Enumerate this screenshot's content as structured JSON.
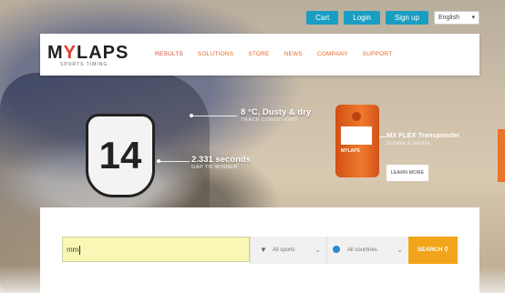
{
  "topbar": {
    "cart_label": "Cart",
    "login_label": "Login",
    "signup_label": "Sign up",
    "language": "English"
  },
  "logo": {
    "text_main_a": "M",
    "text_main_y": "Y",
    "text_main_b": "LAPS",
    "subtitle": "SPORTS TIMING"
  },
  "nav": {
    "items": [
      {
        "label": "Results"
      },
      {
        "label": "Solutions"
      },
      {
        "label": "Store"
      },
      {
        "label": "News"
      },
      {
        "label": "Company"
      },
      {
        "label": "Support"
      }
    ]
  },
  "hero": {
    "number_plate": "14",
    "annotation1": {
      "title": "8 °C, Dusty & dry",
      "sub": "TRACK CONDITIONS"
    },
    "annotation2": {
      "title": "2.331 seconds",
      "sub": "GAP TO WINNER"
    },
    "device_label": "MYLAPS",
    "product": {
      "title": "MX FLEX Transponder",
      "sub": "Durable & reliable",
      "button": "LEARN MORE"
    }
  },
  "search": {
    "input_value": "mm",
    "sports_select": "All sports",
    "countries_select": "All countries",
    "button_label": "SEARCH"
  },
  "colors": {
    "accent_blue": "#1a9dc2",
    "accent_orange": "#f2a51a",
    "brand_red": "#e23b2b"
  }
}
